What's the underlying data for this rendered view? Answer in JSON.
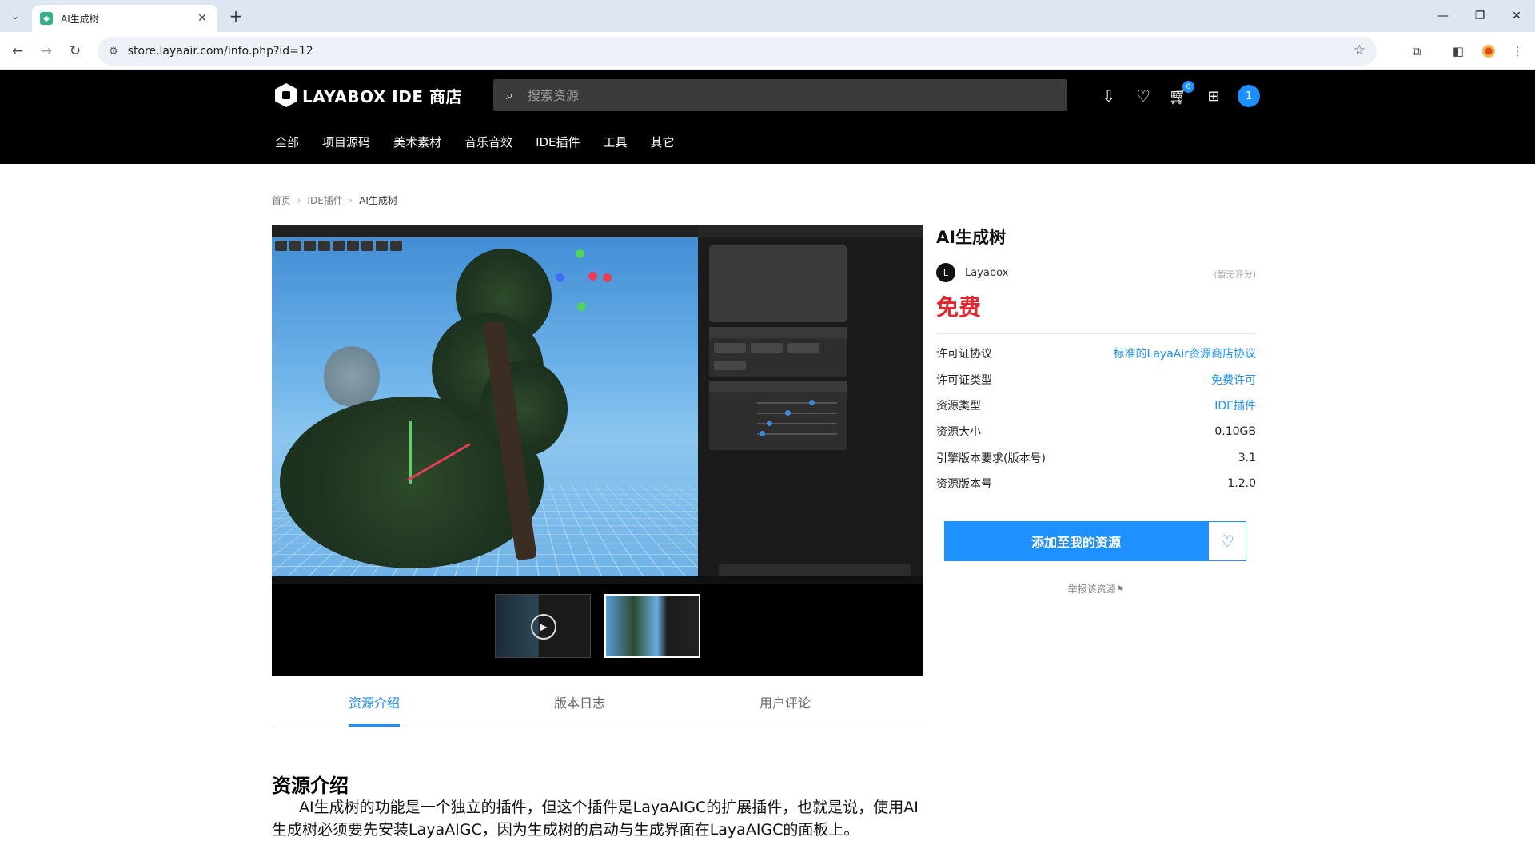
{
  "browser": {
    "tab_title": "AI生成树",
    "url": "store.layaair.com/info.php?id=12"
  },
  "header": {
    "logo_text": "LAYABOX IDE 商店",
    "search_placeholder": "搜索资源",
    "cart_count": "0",
    "user_badge": "1",
    "categories": [
      "全部",
      "项目源码",
      "美术素材",
      "音乐音效",
      "IDE插件",
      "工具",
      "其它"
    ]
  },
  "breadcrumb": {
    "home": "首页",
    "category": "IDE插件",
    "current": "AI生成树"
  },
  "product": {
    "title": "AI生成树",
    "author_initial": "L",
    "author": "Layabox",
    "rating": "(暂无评分)",
    "price": "免费",
    "specs": [
      {
        "label": "许可证协议",
        "value": "标准的LayaAir资源商店协议",
        "link": true
      },
      {
        "label": "许可证类型",
        "value": "免费许可",
        "link": true
      },
      {
        "label": "资源类型",
        "value": "IDE插件",
        "link": true
      },
      {
        "label": "资源大小",
        "value": "0.10GB",
        "link": false
      },
      {
        "label": "引擎版本要求(版本号)",
        "value": "3.1",
        "link": false
      },
      {
        "label": "资源版本号",
        "value": "1.2.0",
        "link": false
      }
    ],
    "add_button": "添加至我的资源",
    "report": "举报该资源⚑"
  },
  "tabs": [
    "资源介绍",
    "版本日志",
    "用户评论"
  ],
  "active_tab": 0,
  "intro": {
    "title": "资源介绍",
    "text": "AI生成树的功能是一个独立的插件，但这个插件是LayaAIGC的扩展插件，也就是说，使用AI生成树必须要先安装LayaAIGC，因为生成树的启动与生成界面在LayaAIGC的面板上。"
  },
  "colors": {
    "accent": "#1e90ff",
    "price": "#e6262e",
    "header_bg": "#000000"
  }
}
